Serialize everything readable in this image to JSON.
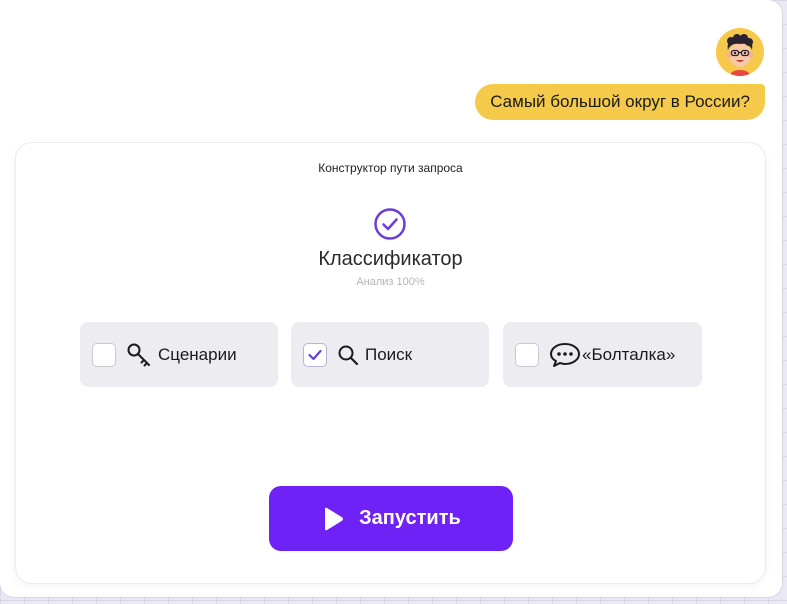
{
  "chat": {
    "user_message": "Самый большой округ в России?",
    "avatar_icon": "boy-avatar-icon"
  },
  "builder": {
    "title": "Конструктор пути запроса",
    "stage": {
      "name": "Классификатор",
      "progress_text": "Анализ 100%",
      "status_icon": "check-circle-icon",
      "progress": 1.0
    },
    "options": [
      {
        "label": "Сценарии",
        "icon": "key-icon",
        "checked": false
      },
      {
        "label": "Поиск",
        "icon": "search-icon",
        "checked": true
      },
      {
        "label": "«Болталка»",
        "icon": "chat-bubble-icon",
        "checked": false
      }
    ],
    "run_button": {
      "label": "Запустить",
      "icon": "play-icon"
    }
  },
  "colors": {
    "accent": "#6f22f6",
    "check": "#6b3fd6",
    "bubble": "#f5c94a",
    "option_bg": "#ededf1"
  }
}
